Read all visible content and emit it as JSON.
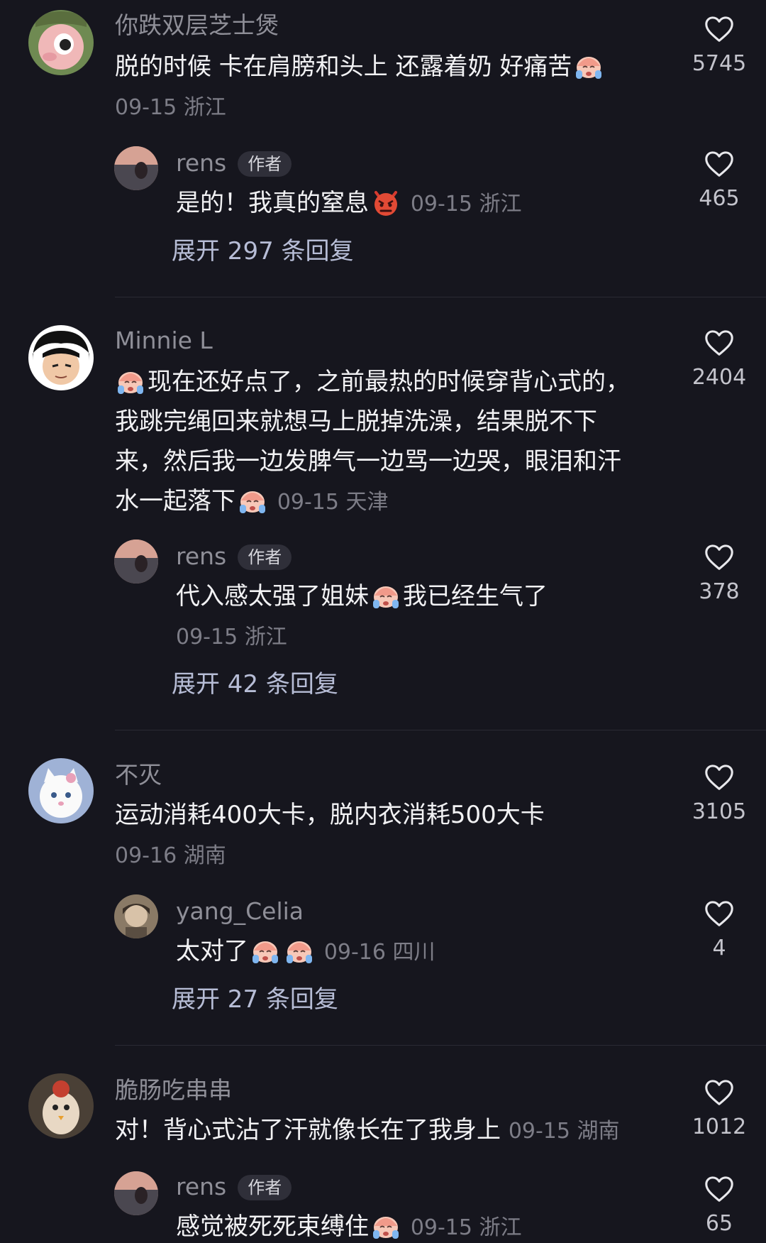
{
  "comments": [
    {
      "username": "你跌双层芝士煲",
      "text_a": "脱的时候 卡在肩膀和头上 还露着奶 好痛苦",
      "emoji_a": "crying-emoji",
      "meta": "09-15 浙江",
      "likes": "5745",
      "reply": {
        "username": "rens",
        "badge": "作者",
        "text_a": "是的！我真的窒息",
        "emoji_a": "angry-devil-emoji",
        "meta": "09-15 浙江",
        "likes": "465"
      },
      "expand": "展开 297 条回复"
    },
    {
      "username": "Minnie L",
      "emoji_a": "crying-emoji",
      "text_a": "现在还好点了，之前最热的时候穿背心式的，",
      "text_b": "我跳完绳回来就想马上脱掉洗澡，结果脱不下",
      "text_c": "来，然后我一边发脾气一边骂一边哭，眼泪和汗",
      "text_d": "水一起落下",
      "emoji_d": "crying-emoji",
      "meta": "09-15 天津",
      "likes": "2404",
      "reply": {
        "username": "rens",
        "badge": "作者",
        "text_a": "代入感太强了姐妹",
        "emoji_a": "crying-emoji",
        "text_b": "我已经生气了",
        "meta": "09-15 浙江",
        "likes": "378"
      },
      "expand": "展开 42 条回复"
    },
    {
      "username": "不灭",
      "text_a": "运动消耗400大卡，脱内衣消耗500大卡",
      "meta": "09-16 湖南",
      "likes": "3105",
      "reply": {
        "username": "yang_Celia",
        "text_a": "太对了",
        "emoji_a": "crying-emoji",
        "emoji_b": "crying-emoji",
        "meta": "09-16 四川",
        "likes": "4"
      },
      "expand": "展开 27 条回复"
    },
    {
      "username": "脆肠吃串串",
      "text_a": "对！背心式沾了汗就像长在了我身上",
      "meta": "09-15 湖南",
      "likes": "1012",
      "reply": {
        "username": "rens",
        "badge": "作者",
        "text_a": "感觉被死死束缚住",
        "emoji_a": "crying-emoji",
        "meta": "09-15 浙江",
        "likes": "65"
      }
    }
  ],
  "colors": {
    "background": "#16161e",
    "username": "#8f8f98",
    "text": "#f2f2f4",
    "meta": "#7d7d87",
    "expand": "#b7bdd6"
  }
}
